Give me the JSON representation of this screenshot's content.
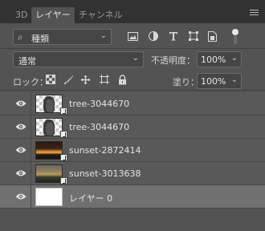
{
  "tabs": [
    {
      "label": "3D"
    },
    {
      "label": "レイヤー"
    },
    {
      "label": "チャンネル"
    }
  ],
  "filter": {
    "kind_label": "種類",
    "icons": [
      "image-filter-icon",
      "adjustment-filter-icon",
      "type-filter-icon",
      "shape-filter-icon",
      "smart-object-filter-icon"
    ]
  },
  "blend": {
    "mode": "通常",
    "opacity_label": "不透明度：",
    "opacity_value": "100%"
  },
  "lock": {
    "label": "ロック：",
    "icons": [
      "lock-transparent-pixels-icon",
      "lock-image-pixels-icon",
      "lock-position-icon",
      "lock-artboard-icon",
      "lock-all-icon"
    ],
    "fill_label": "塗り：",
    "fill_value": "100%"
  },
  "layers": [
    {
      "name": "tree-3044670",
      "thumb": "checker-tree",
      "smart": true,
      "selected": false
    },
    {
      "name": "tree-3044670",
      "thumb": "checker-tree",
      "smart": true,
      "selected": false
    },
    {
      "name": "sunset-2872414",
      "thumb": "sunset1",
      "smart": true,
      "selected": false
    },
    {
      "name": "sunset-3013638",
      "thumb": "sunset2",
      "smart": true,
      "selected": false
    },
    {
      "name": "レイヤー 0",
      "thumb": "white",
      "smart": false,
      "selected": true
    }
  ],
  "colors": {
    "panel_bg": "#535353",
    "selected_row": "#707070"
  }
}
